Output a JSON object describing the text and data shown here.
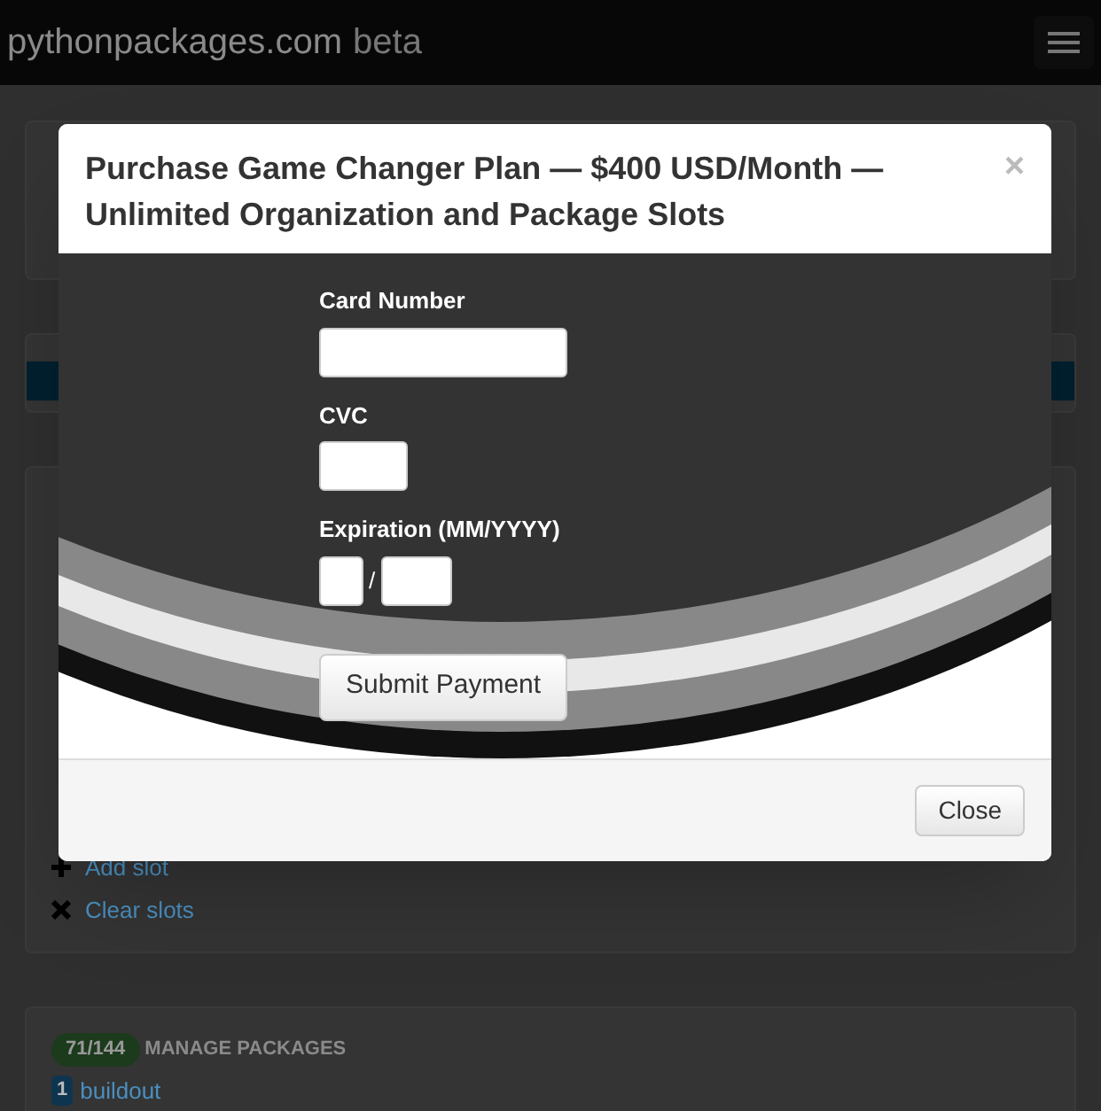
{
  "navbar": {
    "brand": "pythonpackages.com",
    "tag": "beta"
  },
  "progress": {
    "level": 1
  },
  "slots_panel": {
    "actions": [
      {
        "label": "Add slot"
      },
      {
        "label": "Clear slots"
      }
    ]
  },
  "packages_panel": {
    "count": "71/144",
    "title": "MANAGE PACKAGES",
    "packages": [
      {
        "number": "1",
        "name": "buildout"
      }
    ]
  },
  "modal": {
    "title": "Purchase Game Changer Plan — $400 USD/Month — Unlimited Organization and Package Slots",
    "close_glyph": "×",
    "fields": [
      {
        "label": "Card Number",
        "kind": "wide"
      },
      {
        "label": "CVC",
        "kind": "short"
      },
      {
        "label": "Expiration (MM/YYYY)",
        "kind": "date",
        "separator": "/"
      }
    ],
    "submit": "Submit Payment",
    "footer_button": "Close"
  }
}
